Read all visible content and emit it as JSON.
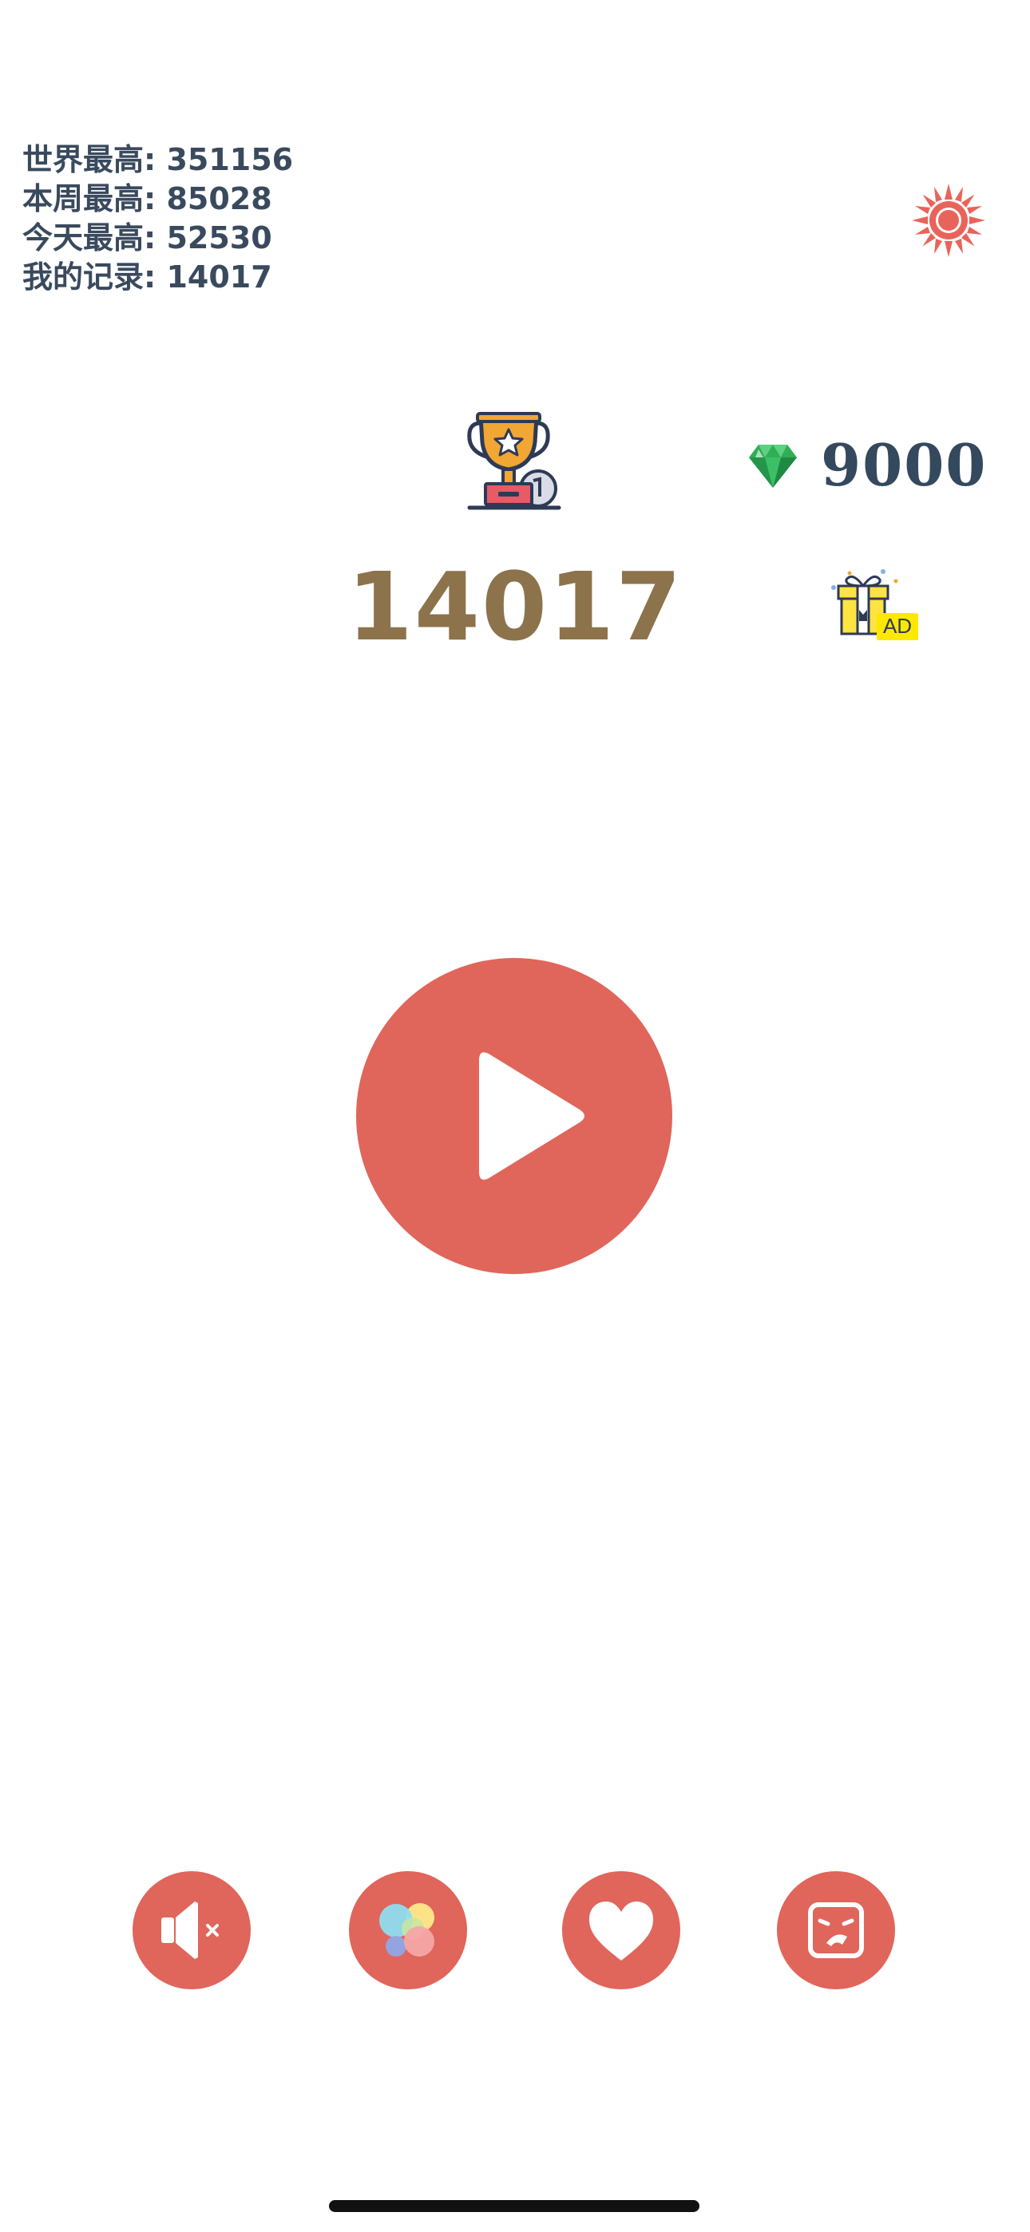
{
  "scores": [
    {
      "label": "世界最高: ",
      "value": "351156"
    },
    {
      "label": "本周最高: ",
      "value": "85028"
    },
    {
      "label": "今天最高: ",
      "value": "52530"
    },
    {
      "label": "我的记录: ",
      "value": "14017"
    }
  ],
  "best_score": "14017",
  "gems": {
    "count": "9000",
    "icon": "diamond-icon"
  },
  "ad_gift": {
    "badge": "AD",
    "icon": "gift-icon"
  },
  "icons": {
    "settings": "sun-icon",
    "trophy": "trophy-icon",
    "play": "play-icon",
    "sound": "speaker-muted-icon",
    "theme": "color-palette-icon",
    "like": "heart-icon",
    "face": "angry-face-icon"
  },
  "colors": {
    "accent": "#e0655b",
    "score_text": "#3a4a5e",
    "best_score": "#8c734b",
    "gem_green": "#2fae55",
    "gem_count": "#34495e"
  }
}
